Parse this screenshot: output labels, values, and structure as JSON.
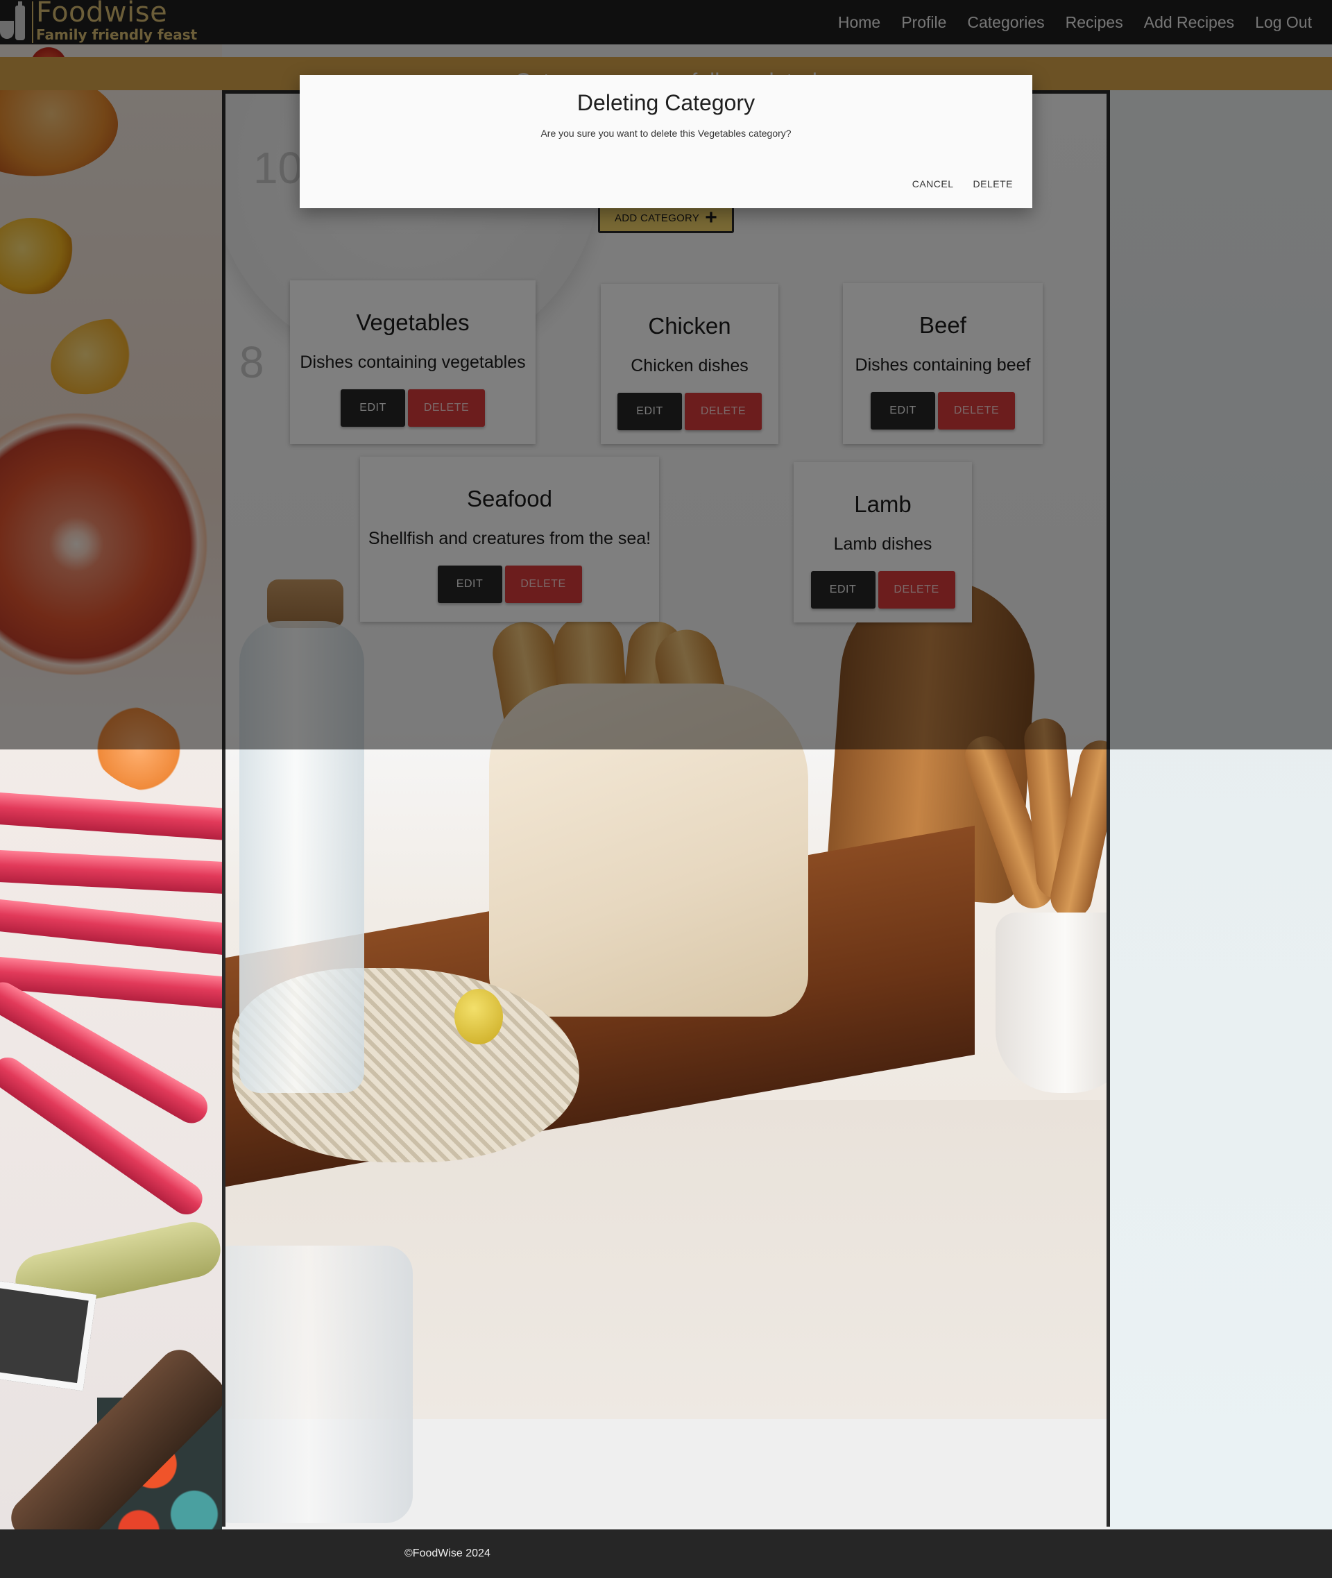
{
  "app": {
    "logo_title": "Foodwise",
    "logo_tagline": "Family friendly feast"
  },
  "nav": {
    "items": [
      {
        "label": "Home"
      },
      {
        "label": "Profile"
      },
      {
        "label": "Categories"
      },
      {
        "label": "Recipes"
      },
      {
        "label": "Add Recipes"
      },
      {
        "label": "Log Out"
      }
    ]
  },
  "flash": {
    "message": "Category successfully updated"
  },
  "toolbar": {
    "add_category_label": "ADD CATEGORY",
    "add_icon": "plus-icon"
  },
  "categories": [
    {
      "name": "Vegetables",
      "description": "Dishes containing vegetables",
      "edit_label": "EDIT",
      "delete_label": "DELETE"
    },
    {
      "name": "Chicken",
      "description": "Chicken dishes",
      "edit_label": "EDIT",
      "delete_label": "DELETE"
    },
    {
      "name": "Beef",
      "description": "Dishes containing beef",
      "edit_label": "EDIT",
      "delete_label": "DELETE"
    },
    {
      "name": "Seafood",
      "description": "Shellfish and creatures from the sea!",
      "edit_label": "EDIT",
      "delete_label": "DELETE"
    },
    {
      "name": "Lamb",
      "description": "Lamb dishes",
      "edit_label": "EDIT",
      "delete_label": "DELETE"
    }
  ],
  "modal": {
    "title": "Deleting Category",
    "message": "Are you sure you want to delete this Vegetables category?",
    "cancel_label": "CANCEL",
    "delete_label": "DELETE"
  },
  "footer": {
    "text": "©FoodWise 2024"
  },
  "colors": {
    "header_bg": "#1f1f1f",
    "brand_gold": "#d9bd72",
    "flash_bg": "#d9a54a",
    "add_button_bg": "#f5d46a",
    "edit_button_bg": "#262626",
    "delete_button_bg": "#d93a3a",
    "footer_bg": "#262626"
  }
}
